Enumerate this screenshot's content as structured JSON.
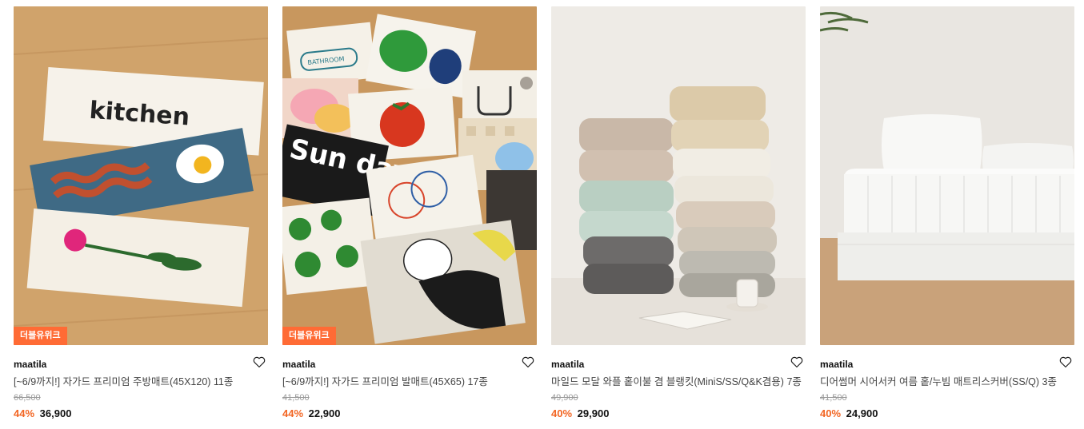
{
  "products": [
    {
      "badge": "더블유위크",
      "brand": "maatila",
      "title": "[~6/9까지!] 자가드 프리미엄 주방매트(45X120) 11종",
      "original_price": "66,500",
      "discount": "44%",
      "price": "36,900",
      "image_text": "kitchen",
      "icon": "heart-icon"
    },
    {
      "badge": "더블유위크",
      "brand": "maatila",
      "title": "[~6/9까지!] 자가드 프리미엄 발매트(45X65) 17종",
      "original_price": "41,500",
      "discount": "44%",
      "price": "22,900",
      "image_text": "Sun day",
      "image_text_2": "BATHROOM",
      "icon": "heart-icon"
    },
    {
      "brand": "maatila",
      "title": "마일드 모달 와플 홑이불 겸 블랭킷(MiniS/SS/Q&K겸용) 7종",
      "original_price": "49,900",
      "discount": "40%",
      "price": "29,900",
      "icon": "heart-icon"
    },
    {
      "brand": "maatila",
      "title": "디어썸머 시어서커 여름 홑/누빔 매트리스커버(SS/Q) 3종",
      "original_price": "41,500",
      "discount": "40%",
      "price": "24,900",
      "icon": "heart-icon"
    }
  ],
  "colors": {
    "discount": "#f26522",
    "badge_bg": "#ff6b35"
  }
}
